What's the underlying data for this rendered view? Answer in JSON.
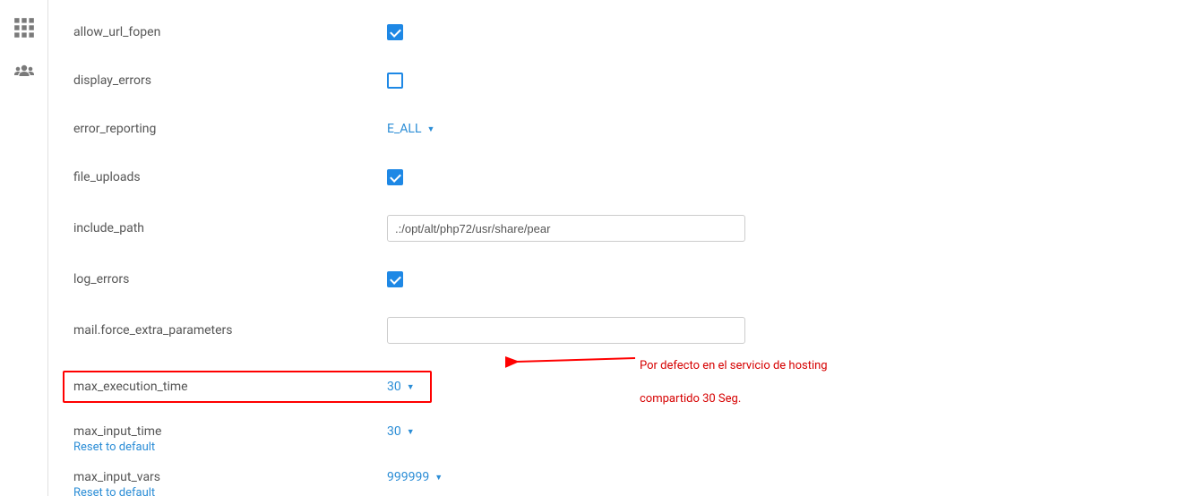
{
  "settings": {
    "allow_url_fopen": {
      "label": "allow_url_fopen",
      "checked": true
    },
    "display_errors": {
      "label": "display_errors",
      "checked": false
    },
    "error_reporting": {
      "label": "error_reporting",
      "value": "E_ALL"
    },
    "file_uploads": {
      "label": "file_uploads",
      "checked": true
    },
    "include_path": {
      "label": "include_path",
      "value": ".:/opt/alt/php72/usr/share/pear"
    },
    "log_errors": {
      "label": "log_errors",
      "checked": true
    },
    "mail_force_extra_parameters": {
      "label": "mail.force_extra_parameters",
      "value": ""
    },
    "max_execution_time": {
      "label": "max_execution_time",
      "value": "30"
    },
    "max_input_time": {
      "label": "max_input_time",
      "value": "30",
      "reset": "Reset to default"
    },
    "max_input_vars": {
      "label": "max_input_vars",
      "value": "999999",
      "reset": "Reset to default"
    }
  },
  "annotation": {
    "line1": "Por defecto en el servicio de hosting",
    "line2": "compartido 30 Seg."
  }
}
